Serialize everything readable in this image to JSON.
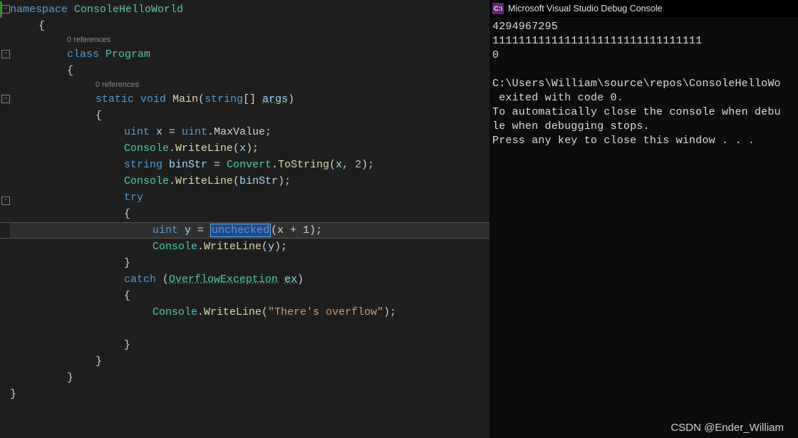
{
  "editor": {
    "codelens": "0 references",
    "fold": "-",
    "tokens": {
      "namespace": "namespace",
      "nsName": "ConsoleHelloWorld",
      "class": "class",
      "program": "Program",
      "static": "static",
      "void": "void",
      "main": "Main",
      "string": "string",
      "args": "args",
      "uint": "uint",
      "x": "x",
      "eq": " = ",
      "maxvalue": "MaxValue",
      "console": "Console",
      "writeline": "WriteLine",
      "stringKw": "string",
      "binStr": "binStr",
      "convert": "Convert",
      "tostring": "ToString",
      "two": "2",
      "try": "try",
      "y": "y",
      "unchecked": "unchecked",
      "plus1": "(x + 1)",
      "catch": "catch",
      "overflowex": "OverflowException",
      "ex": "ex",
      "msg": "\"There's overflow\""
    }
  },
  "console": {
    "title": "Microsoft Visual Studio Debug Console",
    "iconLetters": "C:\\",
    "out": [
      "4294967295",
      "11111111111111111111111111111111",
      "0",
      "",
      "C:\\Users\\William\\source\\repos\\ConsoleHelloWo",
      " exited with code 0.",
      "To automatically close the console when debu",
      "le when debugging stops.",
      "Press any key to close this window . . ."
    ]
  },
  "watermark": "CSDN @Ender_William"
}
